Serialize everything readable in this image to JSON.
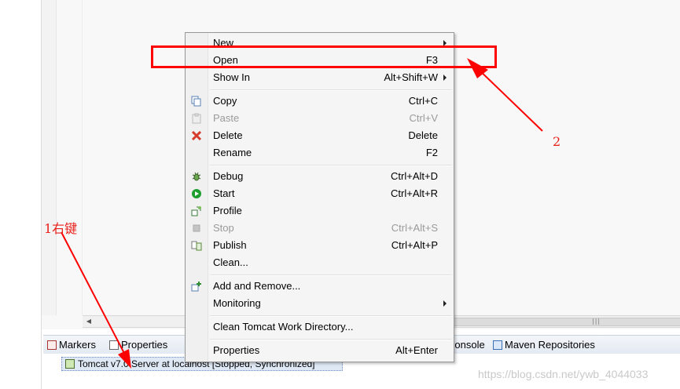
{
  "context_menu": {
    "items": [
      {
        "label": "New",
        "shortcut": "",
        "submenu": true,
        "disabled": false,
        "icon": ""
      },
      {
        "label": "Open",
        "shortcut": "F3",
        "submenu": false,
        "disabled": false,
        "icon": ""
      },
      {
        "label": "Show In",
        "shortcut": "Alt+Shift+W",
        "submenu": true,
        "disabled": false,
        "icon": ""
      },
      {
        "label": "Copy",
        "shortcut": "Ctrl+C",
        "submenu": false,
        "disabled": false,
        "icon": "copy-icon"
      },
      {
        "label": "Paste",
        "shortcut": "Ctrl+V",
        "submenu": false,
        "disabled": true,
        "icon": "paste-icon"
      },
      {
        "label": "Delete",
        "shortcut": "Delete",
        "submenu": false,
        "disabled": false,
        "icon": "delete-icon"
      },
      {
        "label": "Rename",
        "shortcut": "F2",
        "submenu": false,
        "disabled": false,
        "icon": ""
      },
      {
        "label": "Debug",
        "shortcut": "Ctrl+Alt+D",
        "submenu": false,
        "disabled": false,
        "icon": "debug-icon"
      },
      {
        "label": "Start",
        "shortcut": "Ctrl+Alt+R",
        "submenu": false,
        "disabled": false,
        "icon": "start-icon"
      },
      {
        "label": "Profile",
        "shortcut": "",
        "submenu": false,
        "disabled": false,
        "icon": "profile-icon"
      },
      {
        "label": "Stop",
        "shortcut": "Ctrl+Alt+S",
        "submenu": false,
        "disabled": true,
        "icon": "stop-icon"
      },
      {
        "label": "Publish",
        "shortcut": "Ctrl+Alt+P",
        "submenu": false,
        "disabled": false,
        "icon": "publish-icon"
      },
      {
        "label": "Clean...",
        "shortcut": "",
        "submenu": false,
        "disabled": false,
        "icon": ""
      },
      {
        "label": "Add and Remove...",
        "shortcut": "",
        "submenu": false,
        "disabled": false,
        "icon": "add-remove-icon"
      },
      {
        "label": "Monitoring",
        "shortcut": "",
        "submenu": true,
        "disabled": false,
        "icon": ""
      },
      {
        "label": "Clean Tomcat Work Directory...",
        "shortcut": "",
        "submenu": false,
        "disabled": false,
        "icon": ""
      },
      {
        "label": "Properties",
        "shortcut": "Alt+Enter",
        "submenu": false,
        "disabled": false,
        "icon": ""
      }
    ]
  },
  "views_bar": {
    "tabs": [
      {
        "label": "Markers",
        "icon": "markers-icon"
      },
      {
        "label": "Properties",
        "icon": "properties-icon"
      },
      {
        "label": "Console",
        "icon": "console-icon"
      },
      {
        "label": "Maven Repositories",
        "icon": "maven-repositories-icon"
      }
    ]
  },
  "servers": {
    "rows": [
      {
        "label": "Tomcat v7.0 Server at localhost  [Stopped, Synchronized]",
        "icon": "server-icon"
      }
    ]
  },
  "annotations": {
    "step1": "1右键",
    "step2": "2"
  },
  "watermark": "https://blog.csdn.net/ywb_4044033",
  "colors": {
    "annotation_red": "#ff0000",
    "start_green": "#1e9e2e",
    "delete_red": "#d43b2a"
  }
}
